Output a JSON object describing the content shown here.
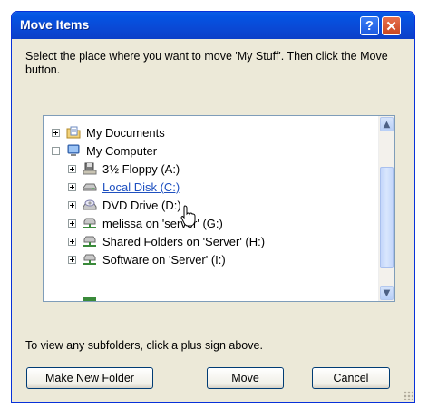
{
  "window": {
    "title": "Move Items",
    "help_glyph": "?",
    "close_glyph": "✕"
  },
  "description": "Select the place where you want to move 'My Stuff'. Then click the Move button.",
  "tree": {
    "items": [
      {
        "label": "My Documents",
        "icon": "my-documents-icon",
        "expander": "plus"
      },
      {
        "label": "My Computer",
        "icon": "computer-icon",
        "expander": "minus"
      },
      {
        "label": "3½ Floppy (A:)",
        "icon": "floppy-icon",
        "expander": "plus"
      },
      {
        "label": "Local Disk (C:)",
        "icon": "hard-disk-icon",
        "expander": "plus",
        "state": "hover"
      },
      {
        "label": "DVD Drive (D:)",
        "icon": "dvd-drive-icon",
        "expander": "plus"
      },
      {
        "label": "melissa on 'server' (G:)",
        "icon": "network-drive-icon",
        "expander": "plus"
      },
      {
        "label": "Shared Folders on 'Server' (H:)",
        "icon": "network-drive-icon",
        "expander": "plus"
      },
      {
        "label": "Software on 'Server' (I:)",
        "icon": "network-drive-icon",
        "expander": "plus"
      }
    ]
  },
  "hint": "To view any subfolders, click a plus sign above.",
  "buttons": {
    "new_folder": "Make New Folder",
    "move": "Move",
    "cancel": "Cancel"
  },
  "colors": {
    "titlebar": "#0a4fd6",
    "dialog_bg": "#ece9d8",
    "link": "#1e50c0",
    "close": "#d4542c"
  }
}
